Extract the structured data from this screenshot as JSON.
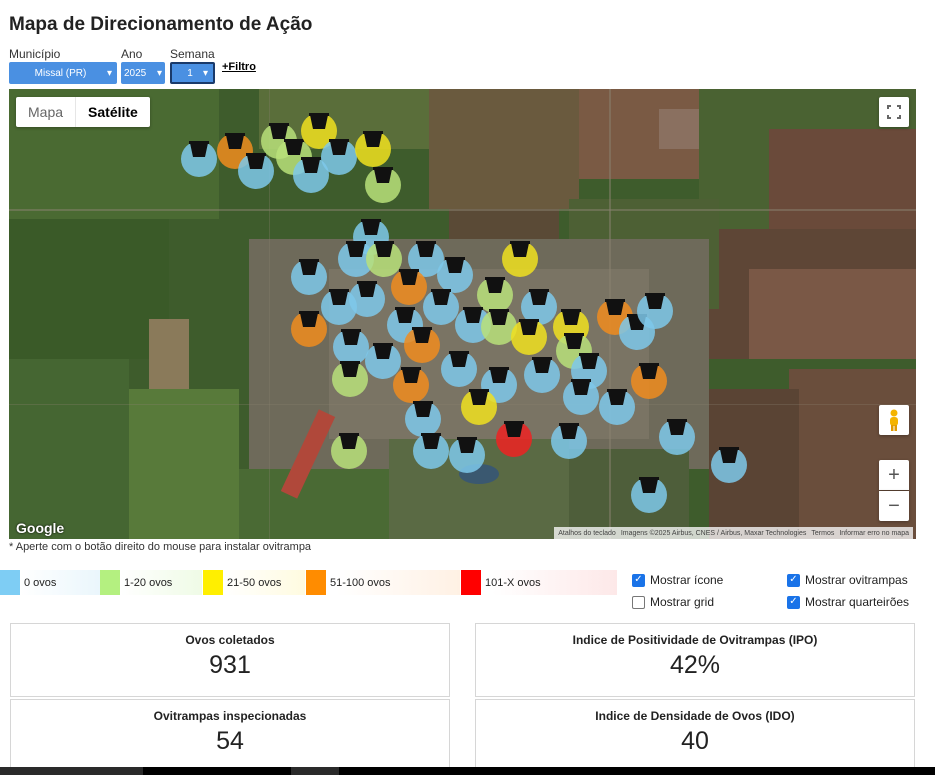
{
  "title": "Mapa de Direcionamento de Ação",
  "filters": {
    "municipio": {
      "label": "Município",
      "value": "Missal (PR)"
    },
    "ano": {
      "label": "Ano",
      "value": "2025"
    },
    "semana": {
      "label": "Semana",
      "value": "1"
    },
    "more": "+Filtro"
  },
  "map": {
    "type_options": [
      "Mapa",
      "Satélite"
    ],
    "selected_type": "Satélite",
    "logo": "Google",
    "attribution": [
      "Atalhos do teclado",
      "Imagens ©2025 Airbus, CNES / Airbus, Maxar Technologies",
      "Termos",
      "Informar erro no mapa"
    ],
    "zoom_in": "+",
    "zoom_out": "−",
    "marker_colors": {
      "zero": "#7ec8ea",
      "low": "#b8e07a",
      "mid": "#f0e020",
      "high": "#f08c1e",
      "max": "#ee2222"
    }
  },
  "hint": "* Aperte com o botão direito do mouse para instalar ovitrampa",
  "legend": [
    {
      "label": "0 ovos",
      "color": "#7ecdf4"
    },
    {
      "label": "1-20 ovos",
      "color": "#b4f080"
    },
    {
      "label": "21-50 ovos",
      "color": "#ffef00"
    },
    {
      "label": "51-100 ovos",
      "color": "#ff8c00"
    },
    {
      "label": "101-X ovos",
      "color": "#ff0000"
    }
  ],
  "options": [
    {
      "label": "Mostrar ícone",
      "checked": true
    },
    {
      "label": "Mostrar grid",
      "checked": false
    },
    {
      "label": "Mostrar ovitrampas",
      "checked": true
    },
    {
      "label": "Mostrar quarteirões",
      "checked": true
    }
  ],
  "stats": [
    {
      "title": "Ovos coletados",
      "value": "931"
    },
    {
      "title": "Indice de Positividade de Ovitrampas (IPO)",
      "value": "42%"
    },
    {
      "title": "Ovitrampas inspecionadas",
      "value": "54"
    },
    {
      "title": "Indice de Densidade de Ovos (IDO)",
      "value": "40"
    }
  ]
}
